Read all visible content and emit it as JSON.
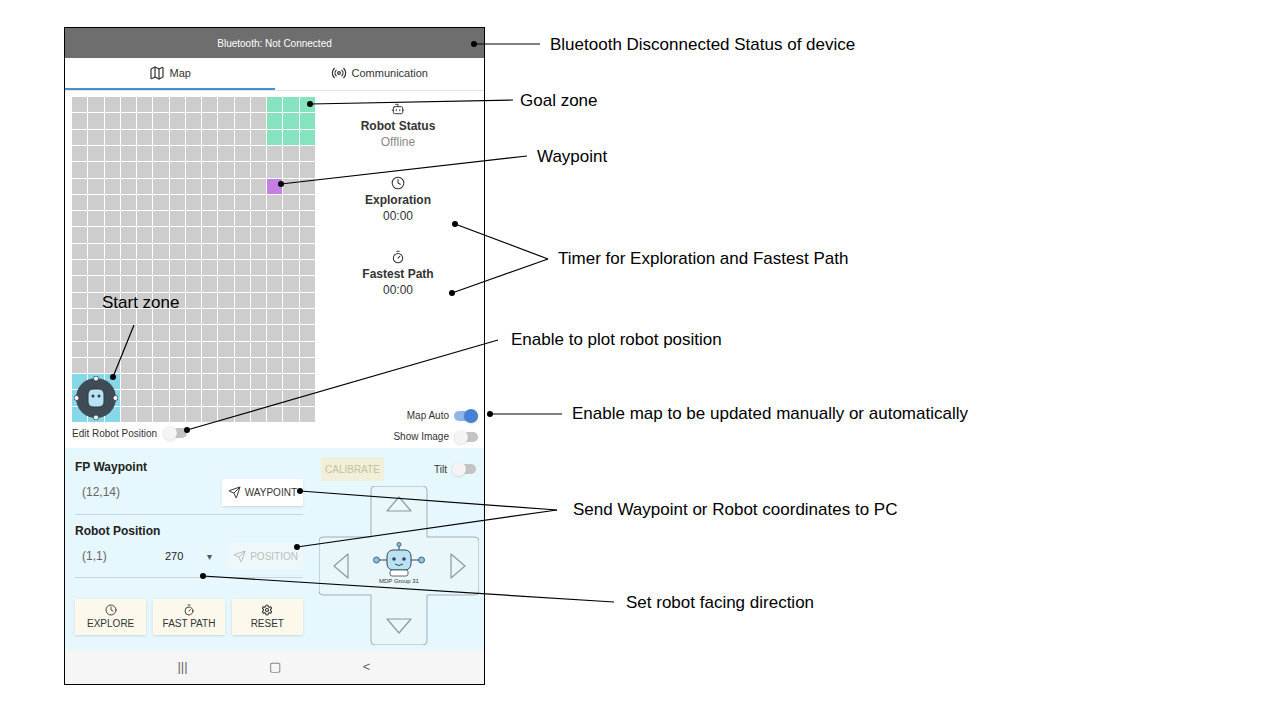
{
  "status_bar": {
    "text": "Bluetooth: Not Connected",
    "connected": false
  },
  "tabs": [
    {
      "label": "Map",
      "selected": true,
      "kind": "map"
    },
    {
      "label": "Communication",
      "selected": false,
      "kind": "signal"
    }
  ],
  "grid": {
    "columns": 15,
    "rows": 20,
    "goal_zone": {
      "col": 12,
      "row": 0,
      "size": 3
    },
    "waypoint": {
      "col": 12,
      "row": 5
    },
    "start_zone": {
      "col": 0,
      "row": 17,
      "size": 3
    }
  },
  "status_panel": [
    {
      "label": "Robot Status",
      "value": "Offline",
      "kind": "robot"
    },
    {
      "label": "Exploration",
      "value": "00:00",
      "kind": "clock"
    },
    {
      "label": "Fastest Path",
      "value": "00:00",
      "kind": "stopwatch"
    }
  ],
  "toggles": {
    "edit_robot_position": {
      "label": "Edit Robot Position",
      "on": false
    },
    "map_auto": {
      "label": "Map Auto",
      "on": true
    },
    "show_image": {
      "label": "Show Image",
      "on": false
    },
    "tilt": {
      "label": "Tilt",
      "on": false
    }
  },
  "waypoint": {
    "label": "FP Waypoint",
    "value": "(12,14)",
    "button": "WAYPOINT",
    "disabled": false
  },
  "calibrate": {
    "label": "CALIBRATE",
    "disabled": true
  },
  "robot_position": {
    "label": "Robot Position",
    "value": "(1,1)",
    "direction": "270",
    "direction_arrow": "▾",
    "button": "POSITION",
    "disabled": true
  },
  "actions": [
    {
      "label": "EXPLORE",
      "kind": "clock"
    },
    {
      "label": "FAST PATH",
      "kind": "stopwatch"
    },
    {
      "label": "RESET",
      "kind": "gear"
    }
  ],
  "dpad": {
    "caption": "MDP Group 31"
  },
  "nav_bar": [
    "|||",
    "▢",
    "<"
  ],
  "annotations": [
    {
      "text": "Bluetooth Disconnected Status of device"
    },
    {
      "text": "Goal zone"
    },
    {
      "text": "Waypoint"
    },
    {
      "text": "Timer for Exploration and Fastest Path"
    },
    {
      "text": "Start zone"
    },
    {
      "text": "Enable to plot robot position"
    },
    {
      "text": "Enable map to be updated manually or automatically"
    },
    {
      "text": "Send Waypoint or Robot coordinates to PC"
    },
    {
      "text": "Set robot facing direction"
    }
  ]
}
